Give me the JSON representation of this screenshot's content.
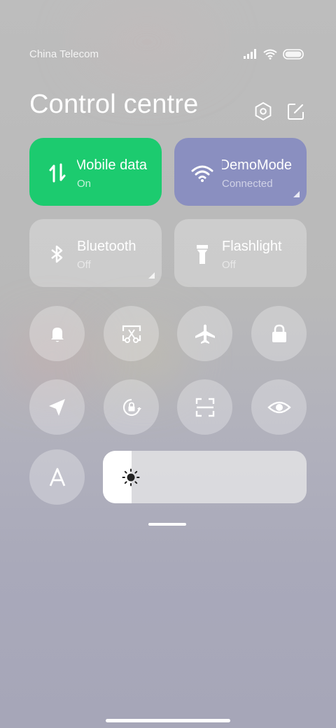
{
  "status_bar": {
    "carrier": "China Telecom"
  },
  "header": {
    "title": "Control centre"
  },
  "tiles": [
    {
      "label": "Mobile data",
      "state": "On",
      "color": "#1ccb6f"
    },
    {
      "label": "DemoMode",
      "state": "Connected",
      "color": "#8a8fc0"
    },
    {
      "label": "Bluetooth",
      "state": "Off"
    },
    {
      "label": "Flashlight",
      "state": "Off"
    }
  ],
  "toggles_row1": [
    "bell-icon",
    "screenshot-icon",
    "airplane-icon",
    "lock-icon"
  ],
  "toggles_row2": [
    "location-icon",
    "rotation-lock-icon",
    "scan-icon",
    "eye-icon"
  ],
  "brightness": {
    "level": 0.14
  }
}
